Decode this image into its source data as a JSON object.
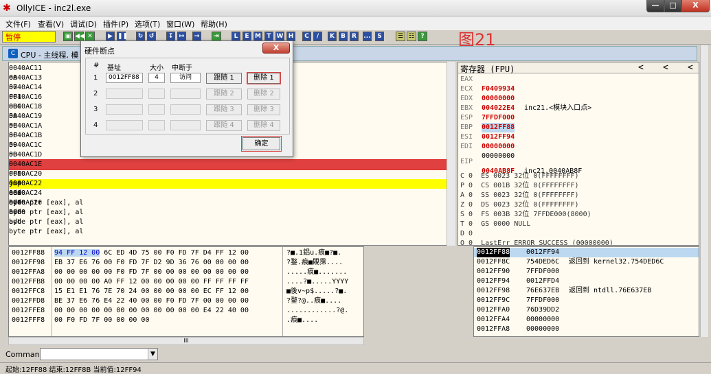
{
  "window": {
    "title": "OllyICE - inc2l.exe",
    "min": "—",
    "max": "□",
    "close": "X"
  },
  "menu": [
    "文件(F)",
    "查看(V)",
    "调试(D)",
    "插件(P)",
    "选项(T)",
    "窗口(W)",
    "帮助(H)"
  ],
  "toolbar": {
    "status": "暂停",
    "buttons": [
      "▣",
      "◀◀",
      "✕",
      "▶",
      "❚❚",
      "↻",
      "↺",
      "↧",
      "↦",
      "→",
      "⇥"
    ],
    "letters": [
      "L",
      "E",
      "M",
      "T",
      "W",
      "H",
      "C",
      "/",
      "K",
      "B",
      "R",
      "...",
      "S"
    ],
    "extra": [
      "☰",
      "☷",
      "?"
    ]
  },
  "figure_label": "图21",
  "cpu_window": {
    "title": "CPU - 主线程, 模"
  },
  "disasm": [
    {
      "addr": "0040AC11",
      "hex": "6A",
      "mn": "",
      "op": ""
    },
    {
      "addr": "0040AC13",
      "hex": "57",
      "mn": "",
      "op": ""
    },
    {
      "addr": "0040AC14",
      "hex": "FF1",
      "mn": "",
      "op": ""
    },
    {
      "addr": "0040AC16",
      "hex": "8BC",
      "mn": "",
      "op": ""
    },
    {
      "addr": "0040AC18",
      "hex": "5A",
      "mn": "",
      "op": ""
    },
    {
      "addr": "0040AC19",
      "hex": "5E",
      "mn": "",
      "op": ""
    },
    {
      "addr": "0040AC1A",
      "hex": "5F",
      "mn": "",
      "op": ""
    },
    {
      "addr": "0040AC1B",
      "hex": "59",
      "mn": "",
      "op": ""
    },
    {
      "addr": "0040AC1C",
      "hex": "5B",
      "mn": "",
      "op": ""
    },
    {
      "addr": "0040AC1D",
      "hex": "5D",
      "mn": "",
      "op": ""
    },
    {
      "addr": "0040AC1E",
      "hex": "FFE0",
      "mn": "jmp",
      "op": "eax"
    },
    {
      "addr": "0040AC20",
      "hex": "0000",
      "mn": "add",
      "op": "byte ptr [eax], al"
    },
    {
      "addr": "0040AC22",
      "hex": "0000",
      "mn": "add",
      "op": "byte ptr [eax], al"
    },
    {
      "addr": "0040AC24",
      "hex": "0000",
      "mn": "add",
      "op": "byte ptr [eax], al"
    },
    {
      "addr": "0040AC26",
      "hex": "0000",
      "mn": "add",
      "op": "byte ptr [eax], al"
    }
  ],
  "registers": {
    "title": "寄存器 (FPU)",
    "arrows": [
      "<",
      "<",
      "<"
    ],
    "gp": [
      {
        "n": "EAX",
        "v": "F0409934",
        "note": "",
        "style": "red"
      },
      {
        "n": "ECX",
        "v": "00000000",
        "note": "",
        "style": "red"
      },
      {
        "n": "EDX",
        "v": "004022E4",
        "note": "inc21.<模块入口点>",
        "style": "red"
      },
      {
        "n": "EBX",
        "v": "7FFDF000",
        "note": "",
        "style": "red"
      },
      {
        "n": "ESP",
        "v": "0012FF88",
        "note": "",
        "style": "sel"
      },
      {
        "n": "EBP",
        "v": "0012FF94",
        "note": "",
        "style": "red"
      },
      {
        "n": "ESI",
        "v": "00000000",
        "note": "",
        "style": "red"
      },
      {
        "n": "EDI",
        "v": "00000000",
        "note": "",
        "style": ""
      }
    ],
    "eip": {
      "n": "EIP",
      "v": "0040AB8F",
      "note": "inc21.0040AB8F"
    },
    "flags": [
      "C 0  ES 0023 32位 0(FFFFFFFF)",
      "P 0  CS 001B 32位 0(FFFFFFFF)",
      "A 0  SS 0023 32位 0(FFFFFFFF)",
      "Z 0  DS 0023 32位 0(FFFFFFFF)",
      "S 0  FS 003B 32位 7FFDE000(8000)",
      "T 0  GS 0000 NULL",
      "D 0",
      "O 0  LastErr ERROR_SUCCESS (00000000)"
    ]
  },
  "dump": [
    {
      "a": "0012FF88",
      "h": "94 FF 12 00 6C ED 4D 75 00 F0 FD 7F D4 FF 12 00",
      "t": "?■.1鋁u.痕■?■."
    },
    {
      "a": "0012FF98",
      "h": "EB 37 E6 76 00 F0 FD 7F D2 9D 36 76 00 00 00 00",
      "t": "?鍪.痕■覞霈...."
    },
    {
      "a": "0012FFA8",
      "h": "00 00 00 00 00 F0 FD 7F 00 00 00 00 00 00 00 00",
      "t": ".....痕■......."
    },
    {
      "a": "0012FFB8",
      "h": "00 00 00 00 A0 FF 12 00 00 00 00 00 FF FF FF FF",
      "t": "....?■.....YYYY"
    },
    {
      "a": "0012FFC8",
      "h": "15 E1 E1 76 7E 70 24 00 00 00 00 00 EC FF 12 00",
      "t": "■後v~p$.....?■."
    },
    {
      "a": "0012FFD8",
      "h": "BE 37 E6 76 E4 22 40 00 00 F0 FD 7F 00 00 00 00",
      "t": "?鍪?@..痕■...."
    },
    {
      "a": "0012FFE8",
      "h": "00 00 00 00 00 00 00 00 00 00 00 00 E4 22 40 00",
      "t": "............?@."
    },
    {
      "a": "0012FFF8",
      "h": "00 F0 FD 7F 00 00 00 00",
      "t": ".痕■...."
    }
  ],
  "dump_scroll": "III",
  "stack": [
    {
      "a": "0012FF88",
      "v": "0012FF94",
      "n": ""
    },
    {
      "a": "0012FF8C",
      "v": "754DED6C",
      "n": "返回到 kernel32.754DED6C"
    },
    {
      "a": "0012FF90",
      "v": "7FFDF000",
      "n": ""
    },
    {
      "a": "0012FF94",
      "v": "0012FFD4",
      "n": ""
    },
    {
      "a": "0012FF98",
      "v": "76E637EB",
      "n": "返回到 ntdll.76E637EB"
    },
    {
      "a": "0012FF9C",
      "v": "7FFDF000",
      "n": ""
    },
    {
      "a": "0012FFA0",
      "v": "76D39DD2",
      "n": ""
    },
    {
      "a": "0012FFA4",
      "v": "00000000",
      "n": ""
    },
    {
      "a": "0012FFA8",
      "v": "00000000",
      "n": ""
    }
  ],
  "command": {
    "label": "Command",
    "value": "",
    "drop": "▼"
  },
  "status_bar": "起始:12FF88 结束:12FF8B 当前值:12FF94",
  "hw_dialog": {
    "title": "硬件断点",
    "close": "X",
    "headers": [
      "#",
      "基址",
      "大小",
      "中断于"
    ],
    "rows": [
      {
        "n": "1",
        "base": "0012FF88",
        "size": "4",
        "type": "访问",
        "follow": "跟随 1",
        "del": "删除 1"
      },
      {
        "n": "2",
        "base": "",
        "size": "",
        "type": "",
        "follow": "跟随 2",
        "del": "删除 2"
      },
      {
        "n": "3",
        "base": "",
        "size": "",
        "type": "",
        "follow": "跟随 3",
        "del": "删除 3"
      },
      {
        "n": "4",
        "base": "",
        "size": "",
        "type": "",
        "follow": "跟随 4",
        "del": "删除 4"
      }
    ],
    "ok": "确定"
  }
}
